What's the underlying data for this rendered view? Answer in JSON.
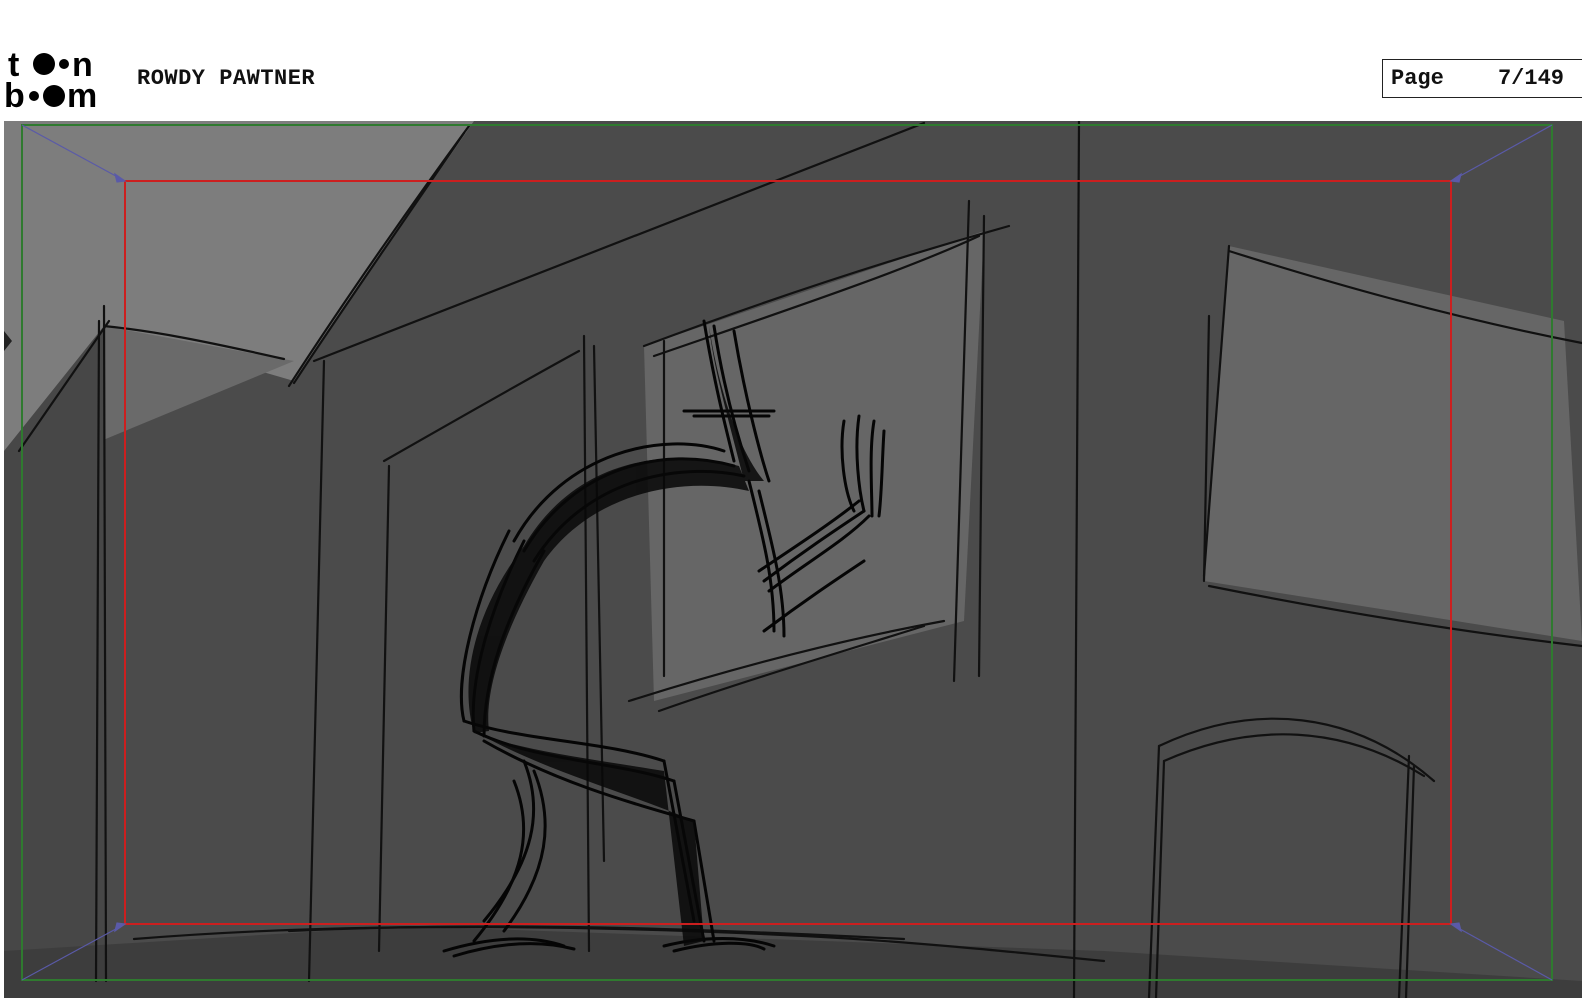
{
  "header": {
    "logo_text": "toon boom",
    "project_title": "ROWDY PAWTNER",
    "page_label": "Page",
    "page_number": "7/149"
  },
  "panel": {
    "camera_frame_color": "#cc1f1f",
    "safe_frame_color": "#2f7a2f",
    "camera_move_arrow_color": "#5a5aa8"
  }
}
